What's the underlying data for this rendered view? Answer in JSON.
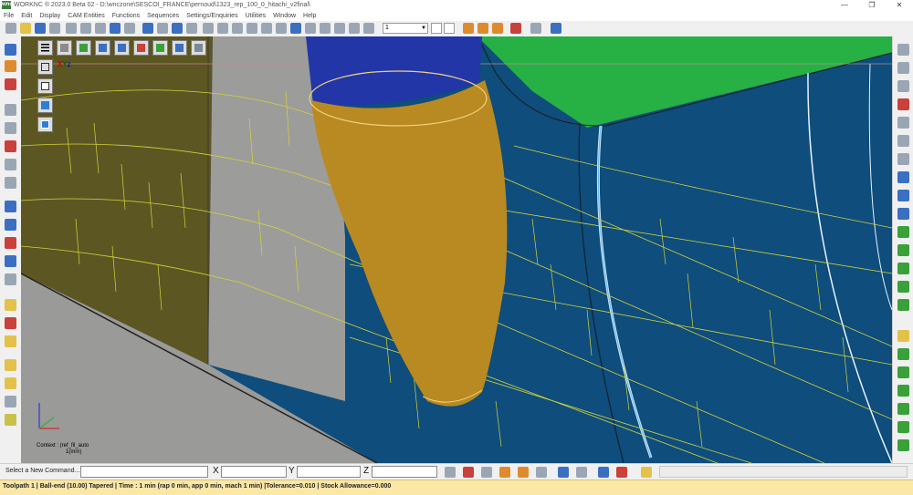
{
  "window": {
    "title": "WORKNC  ® 2023.0 Beta 02 - D:\\wnczone\\SESCOI_FRANCE\\pernoud\\1323_rep_100_0_hitachi_v2final\\",
    "app_icon_label": "wnc",
    "controls": [
      "—",
      "❐",
      "✕"
    ]
  },
  "menu": [
    "File",
    "Edit",
    "Display",
    "CAM Entities",
    "Functions",
    "Sequences",
    "Settings/Enquiries",
    "Utilities",
    "Window",
    "Help"
  ],
  "toolbar": {
    "view_combo_value": "1",
    "blank_combo_value": ""
  },
  "viewport": {
    "menu_button_icon": "hamburger-icon",
    "axis_labels": {
      "x": "X",
      "y": "Y",
      "z": "Z"
    },
    "context_line1": "Context : (ref_fil_auto",
    "context_line2": "1(mm)"
  },
  "command_bar": {
    "prompt": "Select a New Command...",
    "command_value": "",
    "x_label": "X",
    "x_value": "",
    "y_label": "Y",
    "y_value": "",
    "z_label": "Z",
    "z_value": ""
  },
  "status": {
    "text": "Toolpath 1 | Ball-end (10.00) Tapered | Time : 1 min (rap 0 min, app 0 min, mach 1 min) |Tolerance=0.010 | Stock Allowance=0.000"
  },
  "colors": {
    "part_blue": "#0e4d7c",
    "tool_holder": "#b98a22",
    "spindle": "#2236a8",
    "green_face": "#27b044",
    "olive_wall": "#5c5622",
    "grey_wall": "#9c9c9a",
    "toolpath_yellow": "#d6d43a",
    "status_bg": "#fbe7a6"
  }
}
